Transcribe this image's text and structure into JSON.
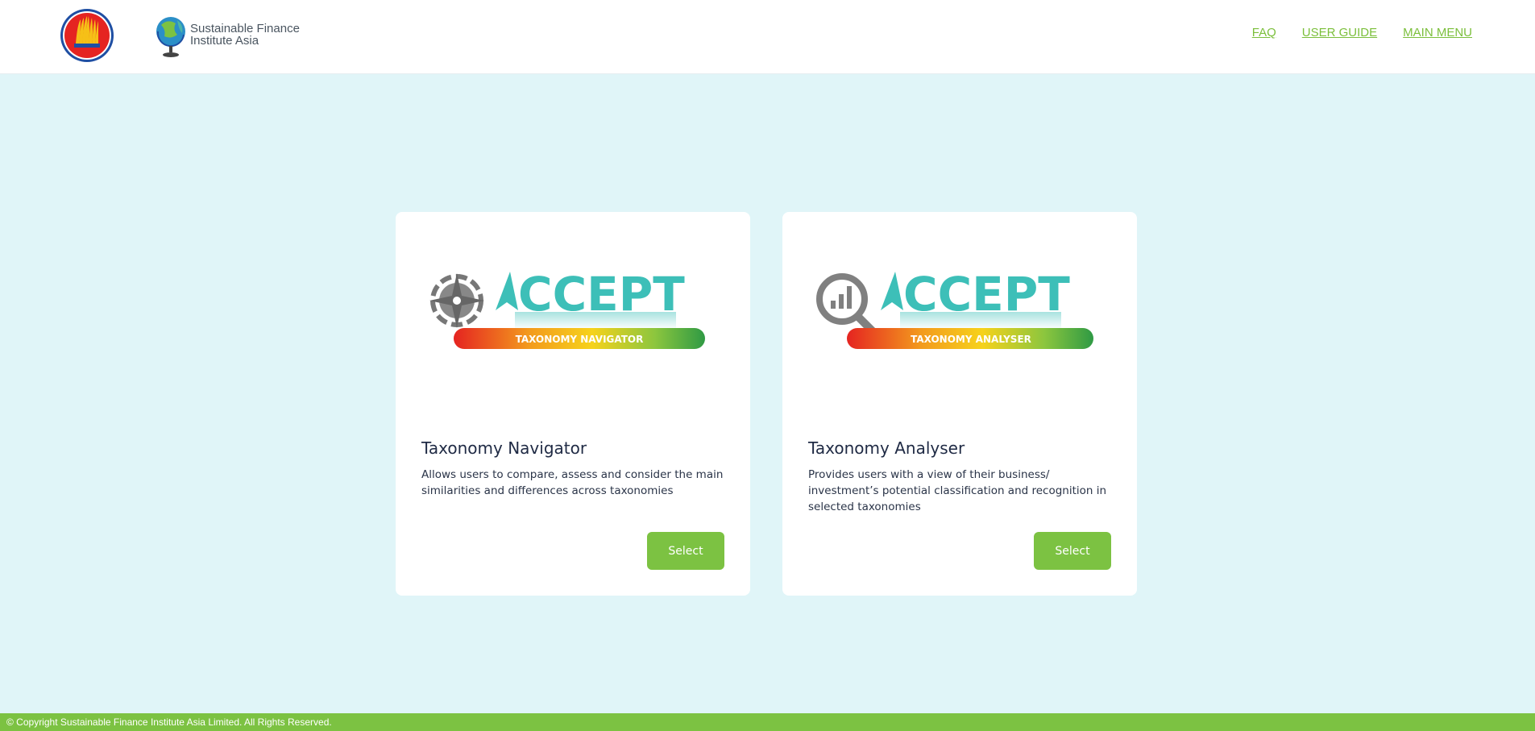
{
  "header": {
    "sfi_logo_line1": "Sustainable Finance",
    "sfi_logo_line2": "Institute Asia",
    "nav": {
      "faq": "FAQ",
      "user_guide": "USER GUIDE",
      "main_menu": "MAIN MENU"
    }
  },
  "cards": [
    {
      "logo_word": "CCEPT",
      "logo_banner": "TAXONOMY NAVIGATOR",
      "logo_icon": "compass-icon",
      "title": "Taxonomy Navigator",
      "description": "Allows users to compare, assess and consider the main similarities and differences across taxonomies",
      "button": "Select"
    },
    {
      "logo_word": "CCEPT",
      "logo_banner": "TAXONOMY ANALYSER",
      "logo_icon": "magnifier-chart-icon",
      "title": "Taxonomy Analyser",
      "description": "Provides users with a view of their business/ investment’s potential classification and recognition in selected taxonomies",
      "button": "Select"
    }
  ],
  "footer": {
    "copyright": "© Copyright Sustainable Finance Institute Asia Limited. All Rights Reserved."
  },
  "colors": {
    "accent_green": "#7cc242",
    "teal": "#3dbfb8",
    "background": "#e0f5f8"
  }
}
